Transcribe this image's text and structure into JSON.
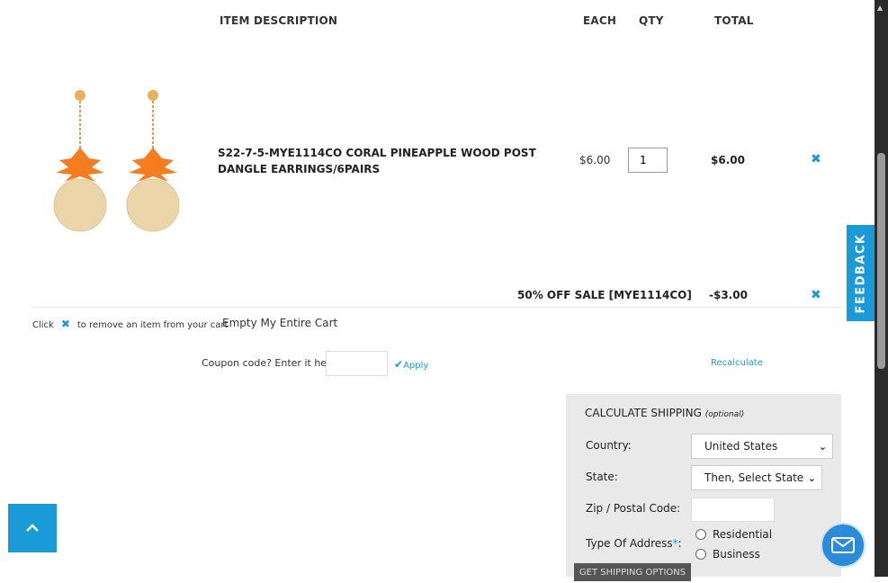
{
  "table_header": {
    "item_description": "ITEM  DESCRIPTION",
    "each": "EACH",
    "qty": "QTY",
    "total": "TOTAL"
  },
  "item": {
    "description": "S22-7-5-MYE1114CO CORAL PINEAPPLE WOOD POST DANGLE EARRINGS/6PAIRS",
    "each": "$6.00",
    "qty": "1",
    "total": "$6.00",
    "remove_icon": "close-icon"
  },
  "discount": {
    "label": "50% OFF SALE [MYE1114CO]",
    "amount": "-$3.00"
  },
  "cart_actions": {
    "hint_prefix": "Click",
    "hint_suffix": "to remove an item from your cart",
    "empty_cart": "Empty My Entire Cart",
    "coupon_label": "Coupon code? Enter it here:",
    "coupon_value": "",
    "apply": "Apply",
    "recalculate": "Recalculate"
  },
  "shipping": {
    "title": "CALCULATE SHIPPING",
    "title_note": "(optional)",
    "country_label": "Country:",
    "country_value": "United States",
    "state_label": "State:",
    "state_value": "Then, Select State",
    "zip_label": "Zip / Postal Code:",
    "zip_value": "",
    "address_type_label": "Type Of Address",
    "required_mark": "*",
    "address_type_suffix": ":",
    "options": [
      "Residential",
      "Business"
    ],
    "get_options_button": "GET SHIPPING OPTIONS"
  },
  "feedback_tab": "FEEDBACK",
  "colors": {
    "accent": "#1a9ad6",
    "shipping_panel_bg": "#e9e9e9",
    "earring_orange": "#f57c1f",
    "earring_wood": "#ecd5a8"
  }
}
